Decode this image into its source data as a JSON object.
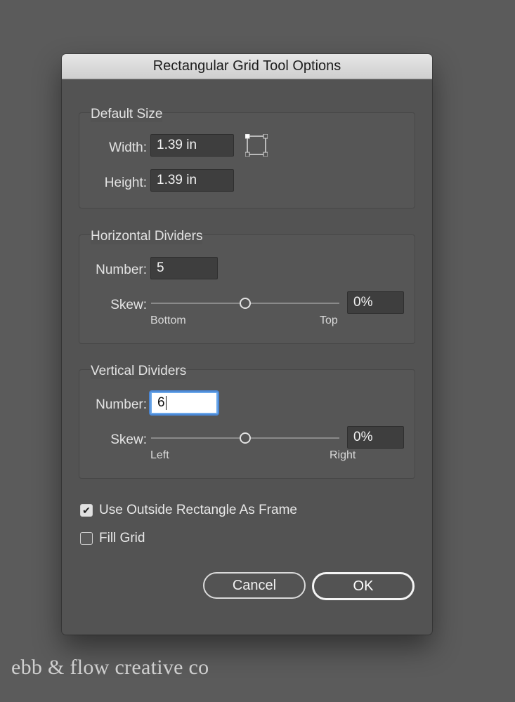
{
  "dialog": {
    "title": "Rectangular Grid Tool Options",
    "default_size": {
      "legend": "Default Size",
      "width_label": "Width:",
      "width_value": "1.39 in",
      "height_label": "Height:",
      "height_value": "1.39 in",
      "reference_point_icon": "reference-point-icon"
    },
    "horizontal_dividers": {
      "legend": "Horizontal Dividers",
      "number_label": "Number:",
      "number_value": "5",
      "skew_label": "Skew:",
      "skew_value": "0%",
      "skew_level": 0.5,
      "left_caption": "Bottom",
      "right_caption": "Top"
    },
    "vertical_dividers": {
      "legend": "Vertical Dividers",
      "number_label": "Number:",
      "number_value": "6",
      "skew_label": "Skew:",
      "skew_value": "0%",
      "skew_level": 0.5,
      "left_caption": "Left",
      "right_caption": "Right"
    },
    "options": {
      "use_outside_label": "Use Outside Rectangle As Frame",
      "use_outside_checked": true,
      "fill_grid_label": "Fill Grid",
      "fill_grid_checked": false
    },
    "buttons": {
      "cancel": "Cancel",
      "ok": "OK"
    }
  },
  "watermark": "ebb & flow creative co",
  "colors": {
    "background": "#5b5b5b",
    "dialog": "#535353",
    "focus": "#4b88d6"
  }
}
